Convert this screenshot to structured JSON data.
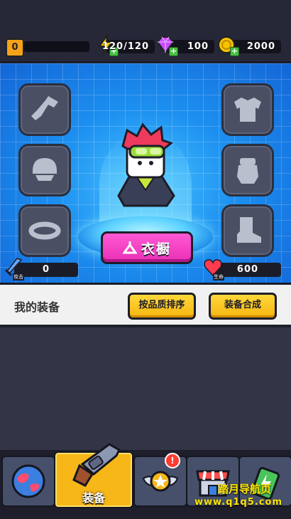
{
  "player": {
    "level": "0"
  },
  "resources": {
    "energy": {
      "value": "120/120",
      "icon": "lightning-icon",
      "color": "#f5c400"
    },
    "gems": {
      "value": "100",
      "icon": "gem-icon",
      "color": "#c64bff"
    },
    "coins": {
      "value": "2000",
      "icon": "coin-icon",
      "color": "#f5c400"
    }
  },
  "showroom": {
    "left_slots": [
      "weapon-slot",
      "helmet-slot",
      "belt-slot"
    ],
    "right_slots": [
      "armor-slot",
      "glove-slot",
      "boots-slot"
    ],
    "wardrobe_label": "衣橱",
    "attack": {
      "value": "0",
      "caption": "攻击"
    },
    "health": {
      "value": "600",
      "caption": "生命"
    }
  },
  "equipment": {
    "title": "我的装备",
    "sort_label": "按品质排序",
    "merge_label": "装备合成"
  },
  "nav": {
    "tabs": [
      {
        "name": "world",
        "label": ""
      },
      {
        "name": "equipment",
        "label": "装备",
        "active": true
      },
      {
        "name": "rank",
        "label": "",
        "badge": "!"
      },
      {
        "name": "shop",
        "label": ""
      },
      {
        "name": "energy",
        "label": ""
      }
    ]
  },
  "watermark": {
    "text": "踏月导航页",
    "url": "www.q1q5.com"
  },
  "colors": {
    "accent_pink": "#ea2fb5",
    "accent_yellow": "#f6b511",
    "grid_blue": "#1c8ff0"
  }
}
